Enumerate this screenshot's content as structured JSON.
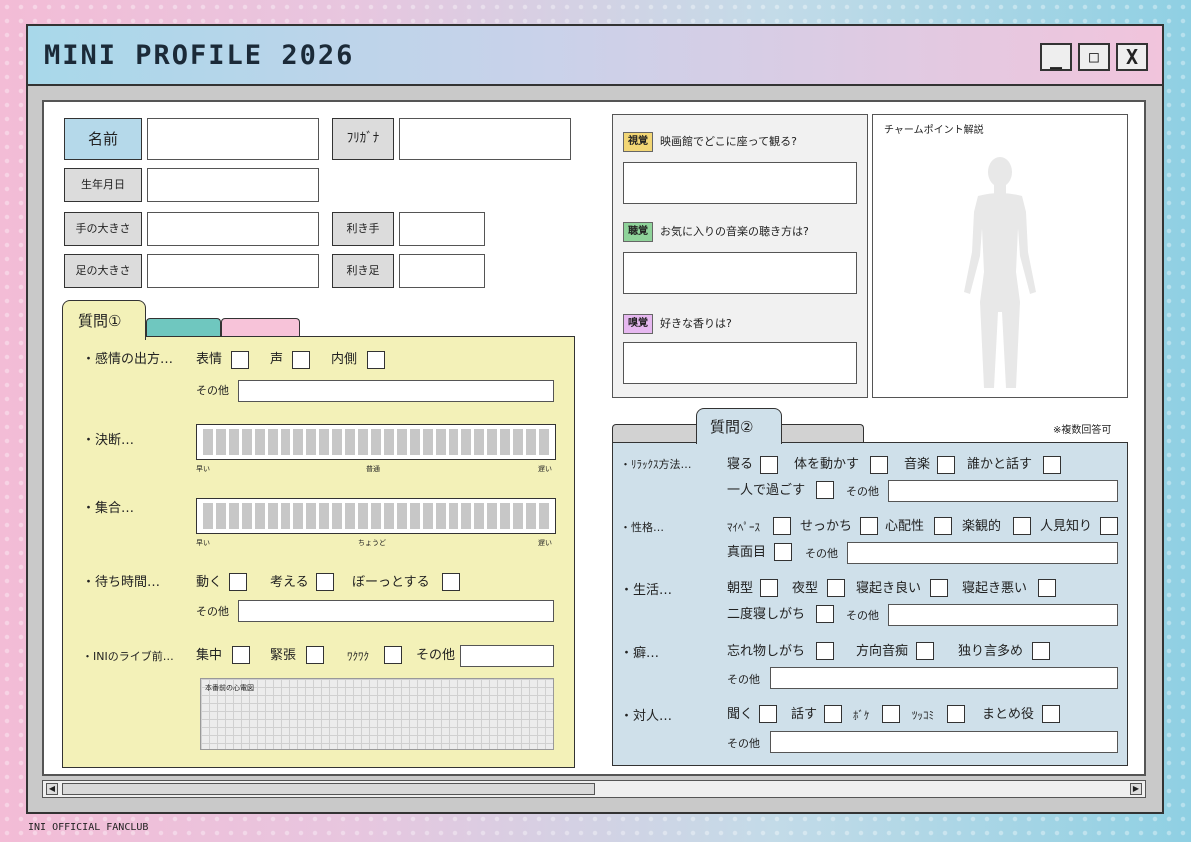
{
  "window": {
    "title": "MINI PROFILE 2026",
    "min": "_",
    "max": "□",
    "close": "X"
  },
  "footer": "INI OFFICIAL FANCLUB",
  "profile": {
    "name": "名前",
    "furigana": "ﾌﾘｶﾞﾅ",
    "birthday": "生年月日",
    "hand_size": "手の大きさ",
    "dominant_hand": "利き手",
    "foot_size": "足の大きさ",
    "dominant_foot": "利き足"
  },
  "q1": {
    "tab": "質問①",
    "emotion": {
      "label": "・感情の出方…",
      "opts": [
        "表情",
        "声",
        "内側"
      ],
      "other": "その他"
    },
    "decision": {
      "label": "・決断…",
      "left": "早い",
      "mid": "普通",
      "right": "遅い"
    },
    "gather": {
      "label": "・集合…",
      "left": "早い",
      "mid": "ちょうど",
      "right": "遅い"
    },
    "wait": {
      "label": "・待ち時間…",
      "opts": [
        "動く",
        "考える",
        "ぼーっとする"
      ],
      "other": "その他"
    },
    "live": {
      "label": "・INIのライブ前…",
      "opts": [
        "集中",
        "緊張",
        "ﾜｸﾜｸ"
      ],
      "other": "その他",
      "ecg": "本番前の心電図"
    }
  },
  "senses": [
    {
      "badge": "視覚",
      "color": "#f2d675",
      "question": "映画館でどこに座って観る?"
    },
    {
      "badge": "聴覚",
      "color": "#8fd39a",
      "question": "お気に入りの音楽の聴き方は?"
    },
    {
      "badge": "嗅覚",
      "color": "#e6b8f0",
      "question": "好きな香りは?"
    }
  ],
  "charm": {
    "title": "チャームポイント解説"
  },
  "q2": {
    "tab": "質問②",
    "note": "※複数回答可",
    "other": "その他",
    "relax": {
      "label": "・ﾘﾗｯｸｽ方法…",
      "row1": [
        "寝る",
        "体を動かす",
        "音楽",
        "誰かと話す"
      ],
      "row2": [
        "一人で過ごす"
      ]
    },
    "personality": {
      "label": "・性格…",
      "row1": [
        "ﾏｲﾍﾟｰｽ",
        "せっかち",
        "心配性",
        "楽観的",
        "人見知り"
      ],
      "row2": [
        "真面目"
      ]
    },
    "life": {
      "label": "・生活…",
      "row1": [
        "朝型",
        "夜型",
        "寝起き良い",
        "寝起き悪い"
      ],
      "row2": [
        "二度寝しがち"
      ]
    },
    "habit": {
      "label": "・癖…",
      "row1": [
        "忘れ物しがち",
        "方向音痴",
        "独り言多め"
      ]
    },
    "social": {
      "label": "・対人…",
      "row1": [
        "聞く",
        "話す",
        "ﾎﾞｹ",
        "ﾂｯｺﾐ",
        "まとめ役"
      ]
    }
  }
}
